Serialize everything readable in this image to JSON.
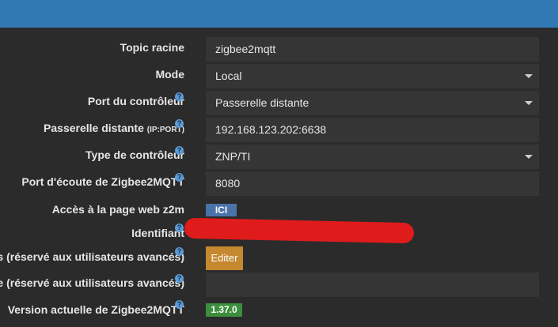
{
  "form": {
    "topic": {
      "label": "Topic racine",
      "value": "zigbee2mqtt"
    },
    "mode": {
      "label": "Mode",
      "value": "Local"
    },
    "controller_port": {
      "label": "Port du contrôleur",
      "value": "Passerelle distante"
    },
    "remote_gateway": {
      "label": "Passerelle distante",
      "label_suffix": "(IP:PORT)",
      "value": "192.168.123.202:6638"
    },
    "controller_type": {
      "label": "Type de contrôleur",
      "value": "ZNP/TI"
    },
    "listen_port": {
      "label": "Port d'écoute de Zigbee2MQTT",
      "value": "8080"
    },
    "web_access": {
      "label": "Accès à la page web z2m",
      "button": "ICI"
    },
    "identifier": {
      "label": "Identifiant"
    },
    "advanced_edit": {
      "label": "s (réservé aux utilisateurs avancés)",
      "button": "Editer"
    },
    "advanced_field": {
      "label": "e (réservé aux utilisateurs avancés)",
      "value": ""
    },
    "version": {
      "label": "Version actuelle de Zigbee2MQTT",
      "value": "1.37.0"
    }
  },
  "icons": {
    "help": "question-circle-icon",
    "caret": "chevron-down-icon"
  },
  "colors": {
    "topbar": "#3279b3",
    "badge_blue": "#4a73a9",
    "button_orange": "#c5882f",
    "badge_green": "#3d8f3d",
    "redaction": "#e01b1b"
  }
}
